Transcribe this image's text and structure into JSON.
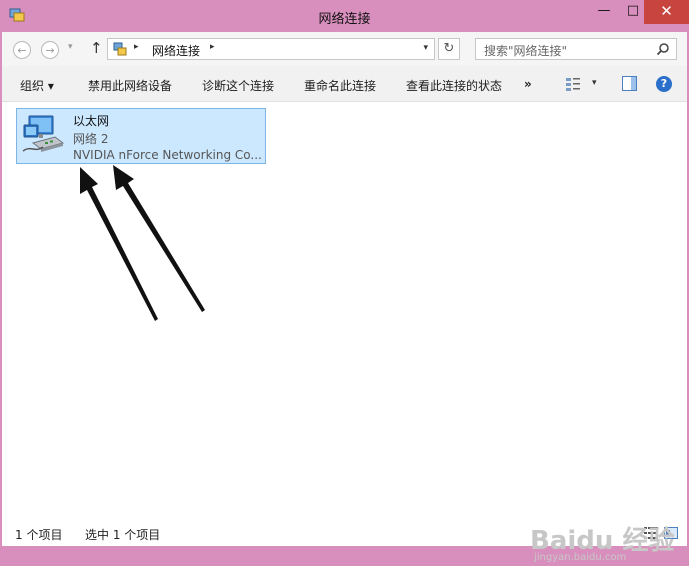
{
  "window": {
    "title": "网络连接"
  },
  "titlebar": {
    "minimize": "—",
    "maximize": "□",
    "close": "✕"
  },
  "nav": {
    "back": "←",
    "forward": "→",
    "dropdown": "▾",
    "up": "↑",
    "address_separator": "▸",
    "address_path": "网络连接",
    "address_dropdown": "▾",
    "refresh": "↻",
    "search_placeholder": "搜索\"网络连接\""
  },
  "toolbar": {
    "organize": "组织 ▾",
    "disable": "禁用此网络设备",
    "diagnose": "诊断这个连接",
    "rename": "重命名此连接",
    "status": "查看此连接的状态",
    "more": "»",
    "view_dropdown": "▾",
    "help": "?"
  },
  "connection": {
    "name": "以太网",
    "network": "网络  2",
    "adapter": "NVIDIA nForce Networking Co..."
  },
  "status": {
    "item_count": "1 个项目",
    "selected_count": "选中 1 个项目"
  },
  "watermark": {
    "main": "Baidu 经验",
    "sub": "jingyan.baidu.com"
  },
  "icons": {
    "app": "network-connections-icon",
    "address": "network-folder-icon",
    "search": "search-icon",
    "view": "change-view-icon",
    "pane": "preview-pane-icon",
    "connection": "ethernet-adapter-icon",
    "details_view": "details-view-icon",
    "tiles_view": "tiles-view-icon"
  },
  "colors": {
    "title_bar": "#d98fbd",
    "close_button": "#c8453f",
    "selection_fill": "#cce8ff",
    "selection_border": "#7eb4ea",
    "arrow": "#111111"
  }
}
